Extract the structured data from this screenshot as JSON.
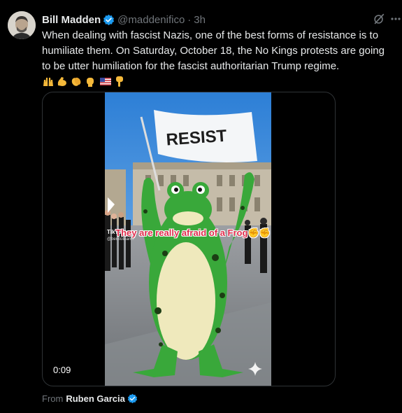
{
  "author": {
    "display_name": "Bill Madden",
    "handle": "@maddenifico",
    "separator": "·",
    "time": "3h",
    "verified_color": "#1d9bf0"
  },
  "post": {
    "text": "When dealing with fascist Nazis, one of the best forms of resistance is to humiliate them. On Saturday, October 18, the No Kings protests are going to be utter humiliation for the fascist authoritarian Trump regime.",
    "emojis": [
      "raising-hands-emoji",
      "flexed-biceps-emoji",
      "clapping-hands-emoji",
      "raised-fist-emoji",
      "us-flag-emoji",
      "backhand-index-pointing-down-emoji"
    ]
  },
  "media": {
    "flag_text": "RESIST",
    "caption": "They are really afraid of a Frog✊✊",
    "watermark_brand": "TikTok",
    "watermark_handle": "@benitoteam7",
    "duration": "0:09"
  },
  "footer": {
    "from_label": "From",
    "from_name": "Ruben Garcia"
  },
  "icons": {
    "grok": "grok-icon",
    "more": "more-icon",
    "sparkle": "sparkle-icon"
  }
}
